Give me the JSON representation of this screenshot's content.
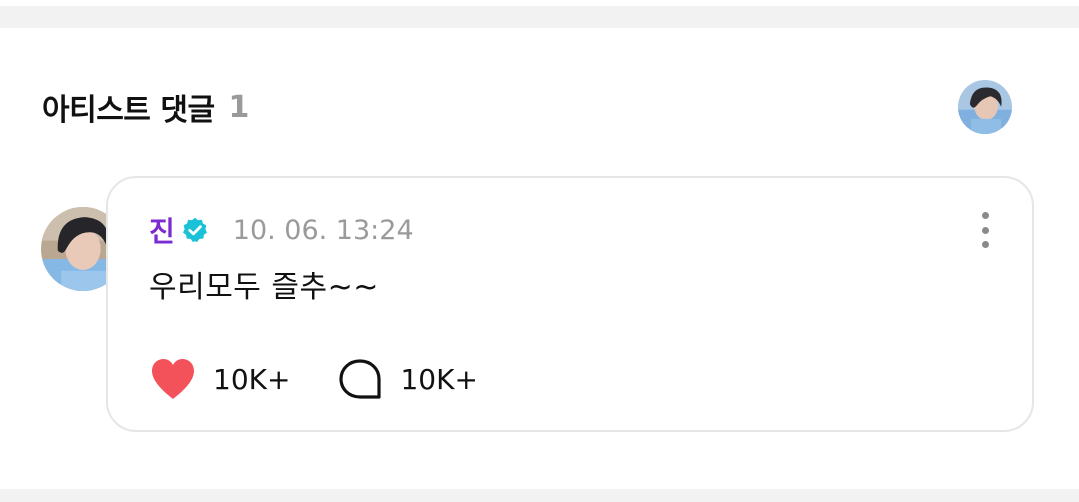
{
  "section": {
    "title": "아티스트 댓글",
    "count": "1"
  },
  "comment": {
    "author": "진",
    "verified_icon": "verified-badge-icon",
    "timestamp": "10. 06. 13:24",
    "text": "우리모두 즐추~~",
    "likes": "10K+",
    "replies": "10K+",
    "more_icon": "more-vertical-icon"
  },
  "icons": {
    "like": "heart-icon",
    "reply": "reply-bubble-icon"
  },
  "colors": {
    "author": "#7b2bd1",
    "verified": "#19c2d6",
    "heart": "#f4525a",
    "muted": "#9a9a9a",
    "card_border": "#e6e6e6",
    "band": "#f2f2f2"
  }
}
